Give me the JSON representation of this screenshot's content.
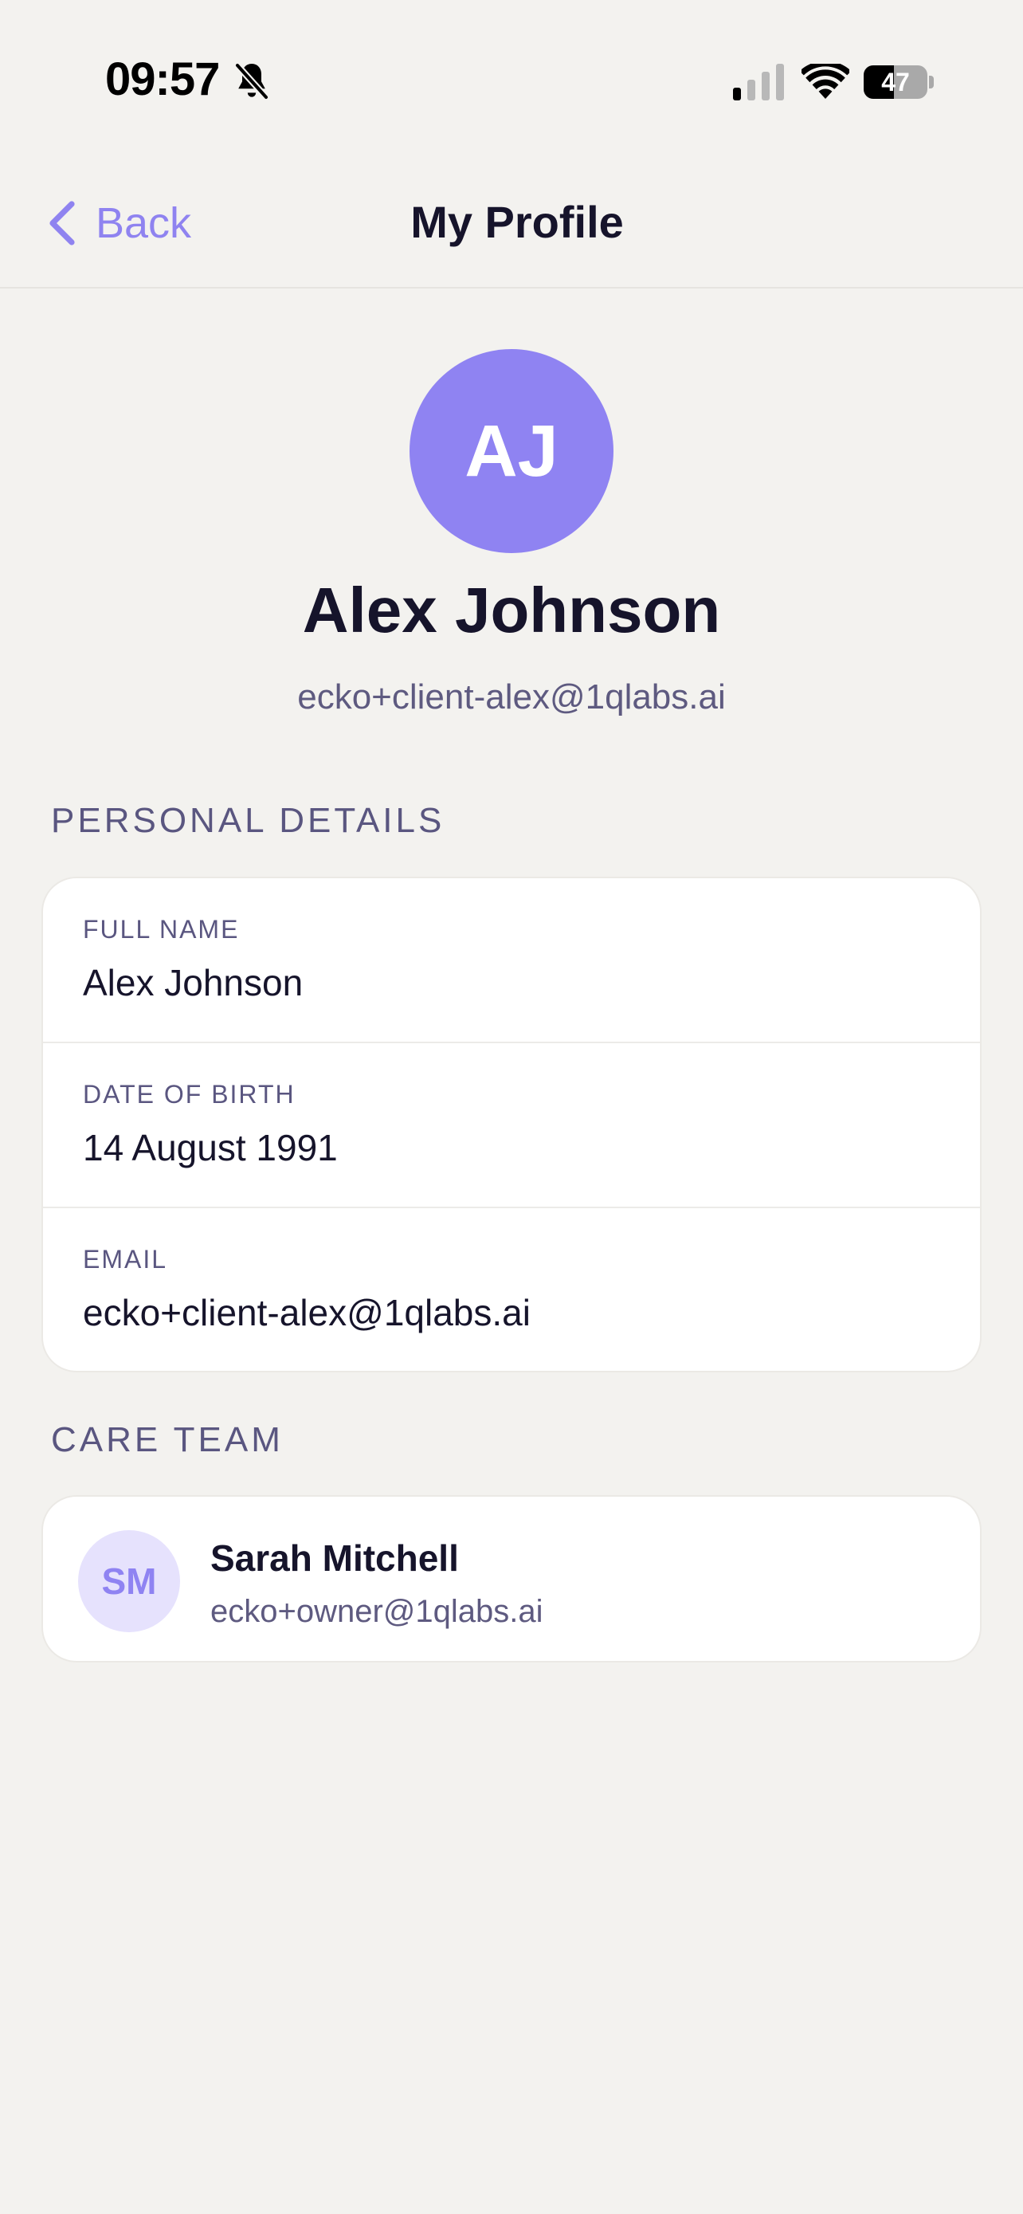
{
  "status_bar": {
    "time": "09:57",
    "battery": "47",
    "battery_percent": 47
  },
  "nav": {
    "back_label": "Back",
    "title": "My Profile"
  },
  "profile": {
    "initials": "AJ",
    "name": "Alex Johnson",
    "email": "ecko+client-alex@1qlabs.ai",
    "avatar_color": "#8f83f2"
  },
  "personal_details": {
    "heading": "PERSONAL DETAILS",
    "fields": [
      {
        "label": "FULL NAME",
        "value": "Alex Johnson"
      },
      {
        "label": "DATE OF BIRTH",
        "value": "14 August 1991"
      },
      {
        "label": "EMAIL",
        "value": "ecko+client-alex@1qlabs.ai"
      }
    ]
  },
  "care_team": {
    "heading": "CARE TEAM",
    "members": [
      {
        "initials": "SM",
        "name": "Sarah Mitchell",
        "email": "ecko+owner@1qlabs.ai"
      }
    ]
  },
  "colors": {
    "accent": "#8f83f0",
    "background": "#f3f2ef",
    "text_primary": "#16142b",
    "text_secondary": "#5a5680"
  },
  "icons": [
    "bell-slash-icon",
    "cellular-signal-icon",
    "wifi-icon",
    "battery-icon",
    "chevron-left-icon"
  ]
}
